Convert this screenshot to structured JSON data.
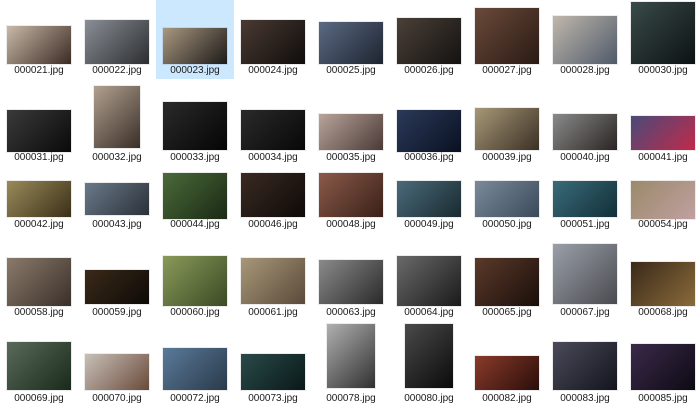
{
  "files": [
    {
      "name": "000021.jpg",
      "tone": [
        "#c9b9a8",
        "#3a2a22"
      ]
    },
    {
      "name": "000022.jpg",
      "tone": [
        "#8a8f96",
        "#2b2d30"
      ]
    },
    {
      "name": "000023.jpg",
      "tone": [
        "#a89880",
        "#1d1a18"
      ],
      "selected": true
    },
    {
      "name": "000024.jpg",
      "tone": [
        "#4a3a32",
        "#0f0d0c"
      ]
    },
    {
      "name": "000025.jpg",
      "tone": [
        "#5a6a82",
        "#1e2430"
      ]
    },
    {
      "name": "000026.jpg",
      "tone": [
        "#4a4038",
        "#141210"
      ]
    },
    {
      "name": "000027.jpg",
      "tone": [
        "#6a4a3a",
        "#2a1a14"
      ]
    },
    {
      "name": "000028.jpg",
      "tone": [
        "#c0b8ac",
        "#505a6a"
      ]
    },
    {
      "name": "000030.jpg",
      "tone": [
        "#3a4a4a",
        "#0c1212"
      ]
    },
    {
      "name": "000031.jpg",
      "tone": [
        "#3a3a3a",
        "#0a0a0a"
      ]
    },
    {
      "name": "000032.jpg",
      "tone": [
        "#b0a090",
        "#3a2e26"
      ]
    },
    {
      "name": "000033.jpg",
      "tone": [
        "#2a2a2a",
        "#050505"
      ]
    },
    {
      "name": "000034.jpg",
      "tone": [
        "#2a2a2a",
        "#080808"
      ]
    },
    {
      "name": "000035.jpg",
      "tone": [
        "#b8a49a",
        "#4a3a36"
      ]
    },
    {
      "name": "000036.jpg",
      "tone": [
        "#2a3a5a",
        "#0a1020"
      ]
    },
    {
      "name": "000039.jpg",
      "tone": [
        "#a89878",
        "#3a3024"
      ]
    },
    {
      "name": "000040.jpg",
      "tone": [
        "#8a8a8a",
        "#2a2424"
      ]
    },
    {
      "name": "000041.jpg",
      "tone": [
        "#4a4a7a",
        "#c02a4a"
      ]
    },
    {
      "name": "000042.jpg",
      "tone": [
        "#9a8a5a",
        "#3a3018"
      ]
    },
    {
      "name": "000043.jpg",
      "tone": [
        "#6a7a8a",
        "#2a3038"
      ]
    },
    {
      "name": "000044.jpg",
      "tone": [
        "#4a6a3a",
        "#1a2a14"
      ]
    },
    {
      "name": "000046.jpg",
      "tone": [
        "#3a2a22",
        "#0e0a08"
      ]
    },
    {
      "name": "000048.jpg",
      "tone": [
        "#8a5a4a",
        "#3a2018"
      ]
    },
    {
      "name": "000049.jpg",
      "tone": [
        "#4a6a7a",
        "#1a2a30"
      ]
    },
    {
      "name": "000050.jpg",
      "tone": [
        "#7a8a9a",
        "#3a4a5a"
      ]
    },
    {
      "name": "000051.jpg",
      "tone": [
        "#3a6a7a",
        "#123038"
      ]
    },
    {
      "name": "000054.jpg",
      "tone": [
        "#9a8a6a",
        "#c0a0a0"
      ]
    },
    {
      "name": "000058.jpg",
      "tone": [
        "#8a7a6a",
        "#3a302a"
      ]
    },
    {
      "name": "000059.jpg",
      "tone": [
        "#3a2a1a",
        "#0e0a06"
      ]
    },
    {
      "name": "000060.jpg",
      "tone": [
        "#8a9a5a",
        "#3a4a24"
      ]
    },
    {
      "name": "000061.jpg",
      "tone": [
        "#a89878",
        "#5a4a3a"
      ]
    },
    {
      "name": "000063.jpg",
      "tone": [
        "#8a8a8a",
        "#2a2a2a"
      ]
    },
    {
      "name": "000064.jpg",
      "tone": [
        "#6a6a6a",
        "#1a1a1a"
      ]
    },
    {
      "name": "000065.jpg",
      "tone": [
        "#5a3a2a",
        "#1a0e0a"
      ]
    },
    {
      "name": "000067.jpg",
      "tone": [
        "#9aa0a8",
        "#4a4a50"
      ]
    },
    {
      "name": "000068.jpg",
      "tone": [
        "#3a2a1a",
        "#8a6a3a"
      ]
    },
    {
      "name": "000069.jpg",
      "tone": [
        "#5a6a5a",
        "#1a2a1a"
      ]
    },
    {
      "name": "000070.jpg",
      "tone": [
        "#c8c0b8",
        "#6a4a3a"
      ]
    },
    {
      "name": "000072.jpg",
      "tone": [
        "#5a7a9a",
        "#2a3a4a"
      ]
    },
    {
      "name": "000073.jpg",
      "tone": [
        "#2a4a4a",
        "#0a1818"
      ]
    },
    {
      "name": "000078.jpg",
      "tone": [
        "#b0b0b0",
        "#303030"
      ]
    },
    {
      "name": "000080.jpg",
      "tone": [
        "#4a4a4a",
        "#0a0a0a"
      ]
    },
    {
      "name": "000082.jpg",
      "tone": [
        "#8a3a2a",
        "#2a0e0a"
      ]
    },
    {
      "name": "000083.jpg",
      "tone": [
        "#4a4a5a",
        "#14141e"
      ]
    },
    {
      "name": "000085.jpg",
      "tone": [
        "#3a2a4a",
        "#0e0a14"
      ]
    }
  ],
  "colors": {
    "selection": "#cce8ff",
    "label": "#1a1a1a"
  }
}
